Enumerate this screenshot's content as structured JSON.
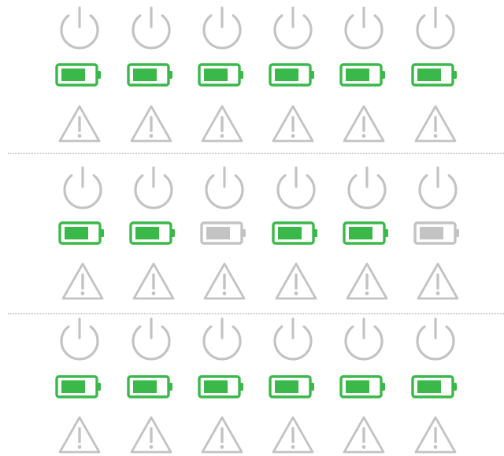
{
  "colors": {
    "icon_gray": "#c3c3c3",
    "battery_ok": "#3bb84a",
    "battery_off": "#c3c3c3",
    "divider": "#9a9a9a"
  },
  "icon_names": {
    "power": "power-icon",
    "battery": "battery-icon",
    "warning": "warning-icon"
  },
  "panels": [
    {
      "name": "panel-1",
      "devices": [
        {
          "power": "off",
          "battery": "charged",
          "warning": "inactive"
        },
        {
          "power": "off",
          "battery": "charged",
          "warning": "inactive"
        },
        {
          "power": "off",
          "battery": "charged",
          "warning": "inactive"
        },
        {
          "power": "off",
          "battery": "charged",
          "warning": "inactive"
        },
        {
          "power": "off",
          "battery": "charged",
          "warning": "inactive"
        },
        {
          "power": "off",
          "battery": "charged",
          "warning": "inactive"
        }
      ]
    },
    {
      "name": "panel-2",
      "devices": [
        {
          "power": "off",
          "battery": "charged",
          "warning": "inactive"
        },
        {
          "power": "off",
          "battery": "charged",
          "warning": "inactive"
        },
        {
          "power": "off",
          "battery": "inactive",
          "warning": "inactive"
        },
        {
          "power": "off",
          "battery": "charged",
          "warning": "inactive"
        },
        {
          "power": "off",
          "battery": "charged",
          "warning": "inactive"
        },
        {
          "power": "off",
          "battery": "inactive",
          "warning": "inactive"
        }
      ]
    },
    {
      "name": "panel-3",
      "devices": [
        {
          "power": "off",
          "battery": "charged",
          "warning": "inactive"
        },
        {
          "power": "off",
          "battery": "charged",
          "warning": "inactive"
        },
        {
          "power": "off",
          "battery": "charged",
          "warning": "inactive"
        },
        {
          "power": "off",
          "battery": "charged",
          "warning": "inactive"
        },
        {
          "power": "off",
          "battery": "charged",
          "warning": "inactive"
        },
        {
          "power": "off",
          "battery": "charged",
          "warning": "inactive"
        }
      ]
    }
  ]
}
